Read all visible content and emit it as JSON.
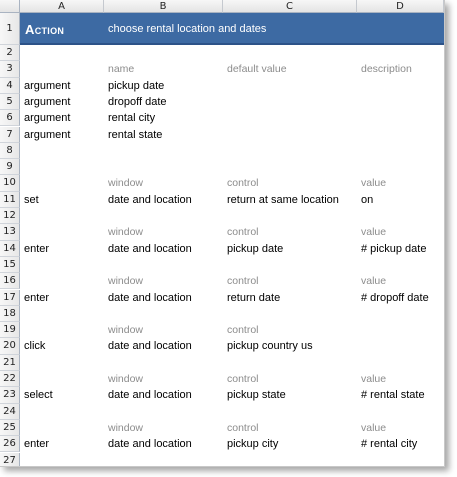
{
  "columns": [
    "A",
    "B",
    "C",
    "D"
  ],
  "row_numbers": [
    "1",
    "2",
    "3",
    "4",
    "5",
    "6",
    "7",
    "8",
    "9",
    "10",
    "11",
    "12",
    "13",
    "14",
    "15",
    "16",
    "17",
    "18",
    "19",
    "20",
    "21",
    "22",
    "23",
    "24",
    "25",
    "26",
    "27"
  ],
  "action": {
    "title": "Action",
    "description": "choose rental location and dates"
  },
  "arguments_header": {
    "name": "name",
    "default_value": "default value",
    "description": "description"
  },
  "arguments": [
    {
      "keyword": "argument",
      "name": "pickup date"
    },
    {
      "keyword": "argument",
      "name": "dropoff date"
    },
    {
      "keyword": "argument",
      "name": "rental city"
    },
    {
      "keyword": "argument",
      "name": "rental state"
    }
  ],
  "steps": [
    {
      "row": 11,
      "h_window": "window",
      "h_control": "control",
      "h_value": "value",
      "action": "set",
      "window": "date and location",
      "control": "return at same location",
      "value": "on"
    },
    {
      "row": 14,
      "h_window": "window",
      "h_control": "control",
      "h_value": "value",
      "action": "enter",
      "window": "date and location",
      "control": "pickup date",
      "value": "# pickup date"
    },
    {
      "row": 17,
      "h_window": "window",
      "h_control": "control",
      "h_value": "value",
      "action": "enter",
      "window": "date and location",
      "control": "return date",
      "value": "# dropoff date"
    },
    {
      "row": 20,
      "h_window": "window",
      "h_control": "control",
      "h_value": "",
      "action": "click",
      "window": "date and location",
      "control": "pickup country us",
      "value": ""
    },
    {
      "row": 23,
      "h_window": "window",
      "h_control": "control",
      "h_value": "value",
      "action": "select",
      "window": "date and location",
      "control": "pickup state",
      "value": "# rental state"
    },
    {
      "row": 26,
      "h_window": "window",
      "h_control": "control",
      "h_value": "value",
      "action": "enter",
      "window": "date and location",
      "control": "pickup city",
      "value": "# rental city"
    }
  ]
}
